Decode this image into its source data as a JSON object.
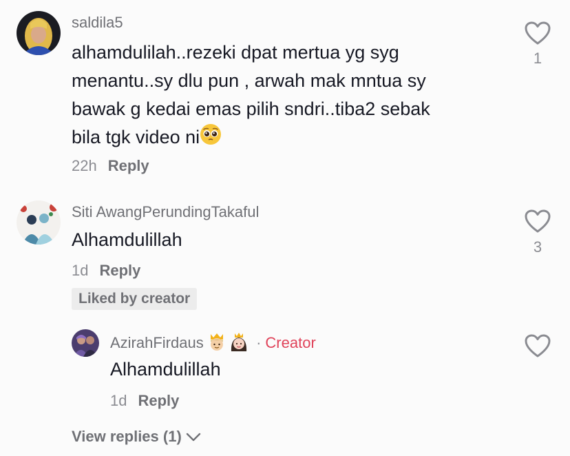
{
  "comments": [
    {
      "username": "saldila5",
      "text_lines": [
        "alhamdulilah..rezeki dpat mertua yg syg",
        "menantu..sy dlu pun , arwah mak mntua sy",
        "bawak g kedai emas pilih sndri..tiba2 sebak",
        "bila tgk video ni"
      ],
      "emoji": "pleading-face",
      "time": "22h",
      "reply_label": "Reply",
      "likes": "1"
    },
    {
      "username": "Siti AwangPerundingTakaful",
      "text": "Alhamdulillah",
      "time": "1d",
      "reply_label": "Reply",
      "likes": "3",
      "liked_badge": "Liked by creator",
      "reply": {
        "username": "AzirahFirdaus",
        "name_emojis": [
          "prince",
          "princess"
        ],
        "separator": "·",
        "creator_label": "Creator",
        "text": "Alhamdulillah",
        "time": "1d",
        "reply_label": "Reply"
      },
      "view_replies": "View replies (1)"
    }
  ],
  "colors": {
    "background": "#fbfbfb",
    "text": "#161823",
    "secondary": "#6f7075",
    "creator": "#e0435a",
    "badge_bg": "#ececec"
  },
  "icons": [
    "heart-icon",
    "chevron-down-icon"
  ]
}
